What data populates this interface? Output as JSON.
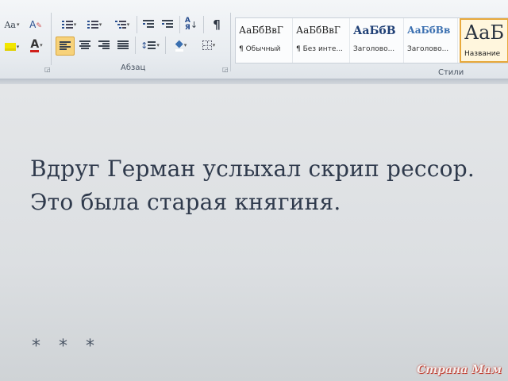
{
  "ribbon": {
    "font_size_label": "Aa",
    "paragraph_group_label": "Абзац",
    "styles_group_label": "Стили",
    "styles": [
      {
        "sample": "АаБбВвГ",
        "name": "¶ Обычный"
      },
      {
        "sample": "АаБбВвГ",
        "name": "¶ Без инте..."
      },
      {
        "sample": "АаБбВ",
        "name": "Заголово..."
      },
      {
        "sample": "АаБбВв",
        "name": "Заголово..."
      },
      {
        "sample": "АаБ",
        "name": "Название"
      }
    ],
    "colors": {
      "accent_selected": "#e8a93c",
      "font_color_red": "#d0201a",
      "highlight_yellow": "#f2e600"
    }
  },
  "document": {
    "line1": "Вдруг Герман услыхал скрип рессор.",
    "line2": "Это была старая княгиня.",
    "separator": "* * *"
  },
  "watermark": "Страна Мам"
}
